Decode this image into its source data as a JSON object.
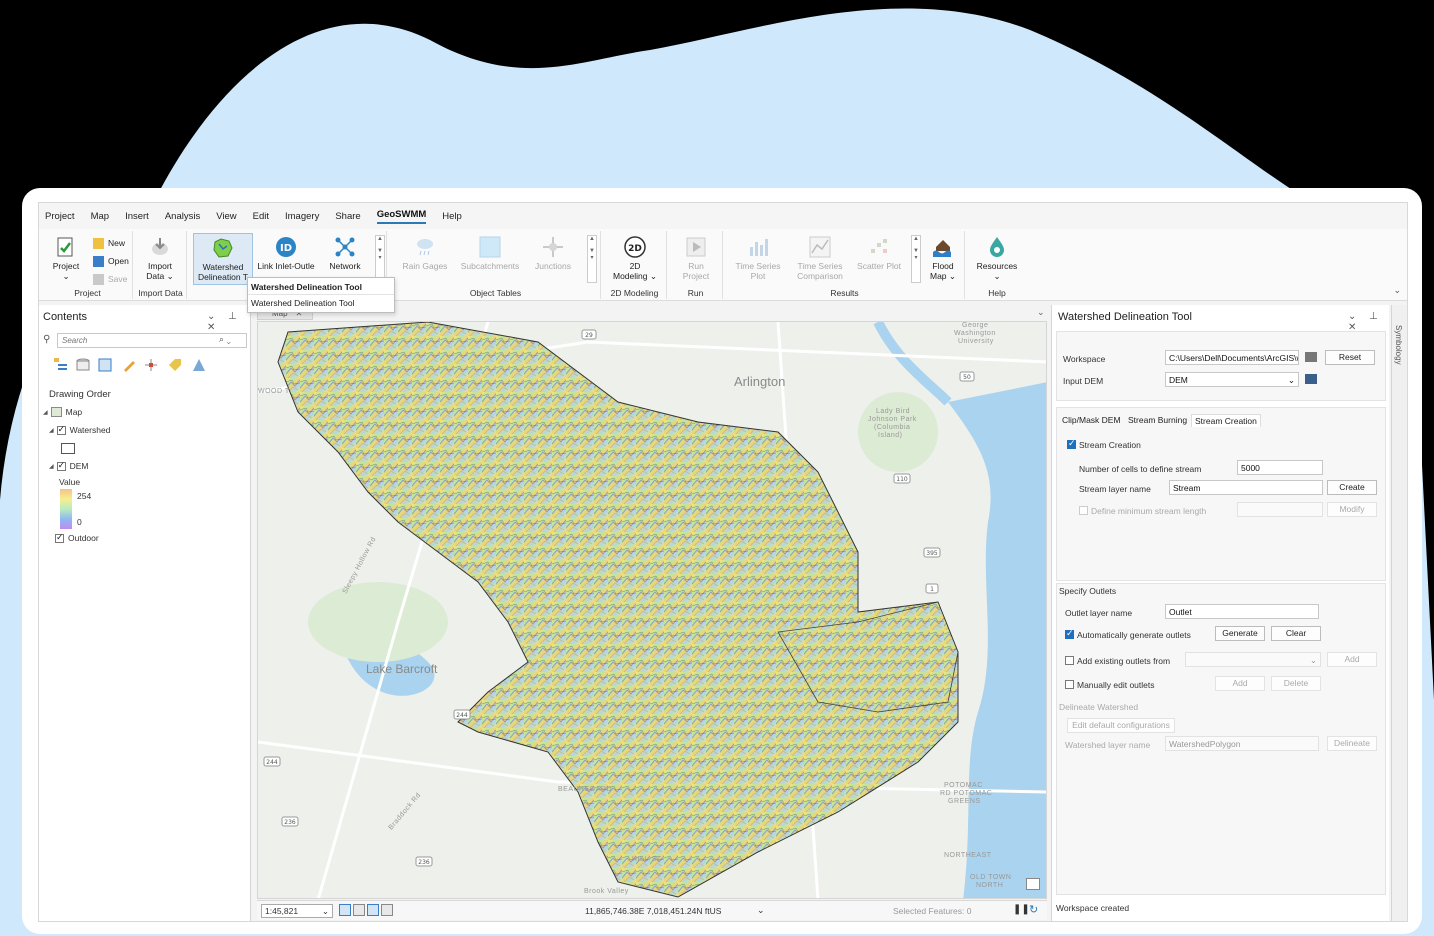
{
  "menu": [
    "Project",
    "Map",
    "Insert",
    "Analysis",
    "View",
    "Edit",
    "Imagery",
    "Share",
    "GeoSWMM",
    "Help"
  ],
  "active_menu": "GeoSWMM",
  "ribbon": {
    "project_group": {
      "label": "Project",
      "project_btn": "Project",
      "new": "New",
      "open": "Open",
      "save": "Save"
    },
    "import_group": {
      "label": "Import Data",
      "import_btn_line1": "Import",
      "import_btn_line2": "Data ⌄"
    },
    "watershed_btn_line1": "Watershed",
    "watershed_btn_line2": "Delineation T",
    "link_btn": "Link Inlet-Outle",
    "network_btn": "Network",
    "object_tables": {
      "label": "Object Tables",
      "rain_gages": "Rain Gages",
      "subcatchments": "Subcatchments",
      "junctions": "Junctions"
    },
    "modeling_2d": {
      "label": "2D Modeling",
      "btn_line1": "2D",
      "btn_line2": "Modeling ⌄"
    },
    "run": {
      "label": "Run",
      "btn_line1": "Run",
      "btn_line2": "Project"
    },
    "results": {
      "label": "Results",
      "ts_plot": "Time Series Plot",
      "ts_cmp_line1": "Time Series",
      "ts_cmp_line2": "Comparison",
      "scatter": "Scatter Plot",
      "flood_line1": "Flood",
      "flood_line2": "Map ⌄"
    },
    "help": {
      "label": "Help",
      "resources": "Resources"
    }
  },
  "tooltip": {
    "title": "Watershed Delineation Tool",
    "description": "Watershed Delineation Tool"
  },
  "contents": {
    "title": "Contents",
    "search_placeholder": "Search",
    "drawing_order": "Drawing Order",
    "map_layer": "Map",
    "watershed_layer": "Watershed",
    "dem_layer": "DEM",
    "value_label": "Value",
    "value_max": "254",
    "value_min": "0",
    "outdoor_layer": "Outdoor"
  },
  "map": {
    "tab_label": "Map",
    "labels": {
      "arlington": "Arlington",
      "lake_barcroft": "Lake Barcroft",
      "george_washington_line1": "George",
      "george_washington_line2": "Washington",
      "george_washington_line3": "University",
      "lady_bird_line1": "Lady Bird",
      "lady_bird_line2": "Johnson Park",
      "lady_bird_line3": "(Columbia",
      "lady_bird_line4": "Island)",
      "beauregard": "BEAUREGARD",
      "northeast": "NORTHEAST",
      "old_town_line1": "OLD TOWN",
      "old_town_line2": "NORTH",
      "potomac_line1": "POTOMAC",
      "potomac_line2": "RD POTOMAC",
      "potomac_line3": "GREENS",
      "brook_valley": "Brook Valley",
      "hill_st": "HILL-ST",
      "wood": "WOOD T",
      "sleepy_hollow": "Sleepy Hollow Rd",
      "braddock": "Braddock Rd"
    },
    "road_shields": [
      "29",
      "50",
      "110",
      "395",
      "1",
      "244",
      "236",
      "244",
      "236"
    ]
  },
  "status": {
    "scale": "1:45,821",
    "coordinates": "11,865,746.38E 7,018,451.24N ftUS",
    "selected_features": "Selected Features: 0"
  },
  "tool": {
    "title": "Watershed Delineation Tool",
    "workspace_label": "Workspace",
    "workspace_value": "C:\\Users\\Dell\\Documents\\ArcGIS\\wa",
    "reset": "Reset",
    "input_dem_label": "Input DEM",
    "input_dem_value": "DEM",
    "tabs": [
      "Clip/Mask DEM",
      "Stream Burning",
      "Stream Creation"
    ],
    "active_tab": "Stream Creation",
    "stream_creation_cb": "Stream Creation",
    "num_cells_label": "Number of cells to define stream",
    "num_cells_value": "5000",
    "stream_layer_label": "Stream layer name",
    "stream_layer_value": "Stream",
    "create": "Create",
    "define_min_label": "Define minimum stream length",
    "modify": "Modify",
    "specify_outlets": "Specify Outlets",
    "outlet_layer_label": "Outlet layer name",
    "outlet_layer_value": "Outlet",
    "auto_outlets_label": "Automatically generate outlets",
    "generate": "Generate",
    "clear": "Clear",
    "add_existing_label": "Add existing outlets from",
    "add": "Add",
    "manual_edit_label": "Manually edit outlets",
    "add2": "Add",
    "delete": "Delete",
    "delineate_watershed": "Delineate Watershed",
    "edit_defaults": "Edit default configurations",
    "watershed_layer_label": "Watershed layer name",
    "watershed_layer_value": "WatershedPolygon",
    "delineate": "Delineate",
    "status_message": "Workspace created",
    "symbology_tab": "Symbology"
  },
  "colors": {
    "accent": "#2a7ab8",
    "blob": "#cfe8fb",
    "checkbox_on": "#1f6fbf"
  }
}
